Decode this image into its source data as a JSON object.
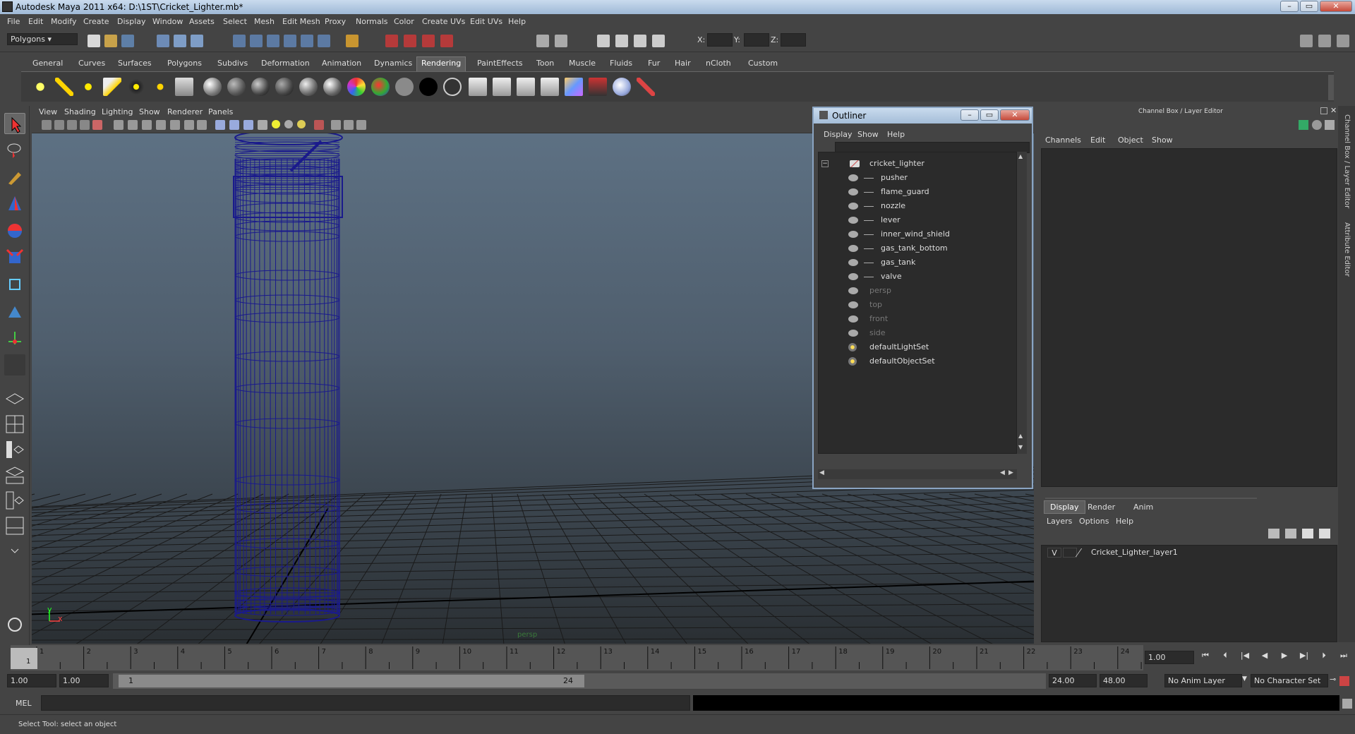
{
  "window": {
    "title": "Autodesk Maya 2011 x64: D:\\1ST\\Cricket_Lighter.mb*"
  },
  "menubar": [
    "File",
    "Edit",
    "Modify",
    "Create",
    "Display",
    "Window",
    "Assets",
    "Select",
    "Mesh",
    "Edit Mesh",
    "Proxy",
    "Normals",
    "Color",
    "Create UVs",
    "Edit UVs",
    "Help"
  ],
  "statusline": {
    "mode": "Polygons",
    "x_label": "X:",
    "y_label": "Y:",
    "z_label": "Z:"
  },
  "shelf_tabs": [
    "General",
    "Curves",
    "Surfaces",
    "Polygons",
    "Subdivs",
    "Deformation",
    "Animation",
    "Dynamics",
    "Rendering",
    "PaintEffects",
    "Toon",
    "Muscle",
    "Fluids",
    "Fur",
    "Hair",
    "nCloth",
    "Custom"
  ],
  "shelf_active": "Rendering",
  "viewport": {
    "menu": [
      "View",
      "Shading",
      "Lighting",
      "Show",
      "Renderer",
      "Panels"
    ],
    "camera_label": "persp",
    "axis_y": "y",
    "axis_x": "x",
    "wire_color": "#1a1a8c"
  },
  "outliner": {
    "title": "Outliner",
    "menu": [
      "Display",
      "Show",
      "Help"
    ],
    "root": "cricket_lighter",
    "children": [
      "pusher",
      "flame_guard",
      "nozzle",
      "lever",
      "inner_wind_shield",
      "gas_tank_bottom",
      "gas_tank",
      "valve"
    ],
    "cameras": [
      "persp",
      "top",
      "front",
      "side"
    ],
    "sets": [
      "defaultLightSet",
      "defaultObjectSet"
    ]
  },
  "channelbox": {
    "title": "Channel Box / Layer Editor",
    "menu": [
      "Channels",
      "Edit",
      "Object",
      "Show"
    ]
  },
  "layer_editor": {
    "tabs": [
      "Display",
      "Render",
      "Anim"
    ],
    "active_tab": "Display",
    "menu": [
      "Layers",
      "Options",
      "Help"
    ],
    "layer_visible": "V",
    "layer_name": "Cricket_Lighter_layer1"
  },
  "sidebar": {
    "channel_label": "Channel Box / Layer Editor",
    "attr_label": "Attribute Editor"
  },
  "timeline": {
    "ticks": [
      "1",
      "2",
      "3",
      "4",
      "5",
      "6",
      "7",
      "8",
      "9",
      "10",
      "11",
      "12",
      "13",
      "14",
      "15",
      "16",
      "17",
      "18",
      "19",
      "20",
      "21",
      "22",
      "23",
      "24"
    ],
    "current_frame": "1",
    "current_time": "1.00"
  },
  "range": {
    "start": "1.00",
    "playback_start": "1.00",
    "range_start_label": "1",
    "range_end_label": "24",
    "playback_end": "24.00",
    "end": "48.00",
    "anim_layer": "No Anim Layer",
    "character_set": "No Character Set"
  },
  "command_line": {
    "label": "MEL"
  },
  "help_line": {
    "text": "Select Tool: select an object"
  }
}
